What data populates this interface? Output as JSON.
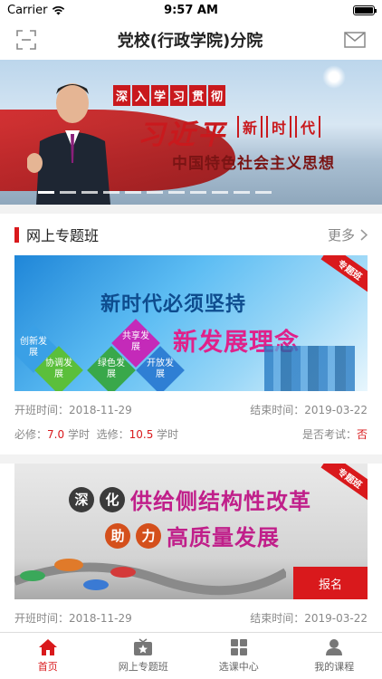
{
  "status_bar": {
    "carrier": "Carrier",
    "time": "9:57 AM"
  },
  "navbar": {
    "title": "党校(行政学院)分院",
    "left_icon": "scan-icon",
    "right_icon": "mail-icon"
  },
  "banner": {
    "tag_chars": [
      "深",
      "入",
      "学",
      "习",
      "贯",
      "彻"
    ],
    "headline": "习近平",
    "headline_side": [
      "新",
      "时",
      "代"
    ],
    "subtitle": "中国特色社会主义思想",
    "dots_count": 11,
    "active_dot": 0
  },
  "section": {
    "title": "网上专题班",
    "more": "更多"
  },
  "courses": [
    {
      "badge": "专题班",
      "image_title": "新时代必须坚持",
      "image_subtitle": "新发展理念",
      "concepts": [
        "创新发展",
        "协调发展",
        "共享发展",
        "绿色发展",
        "开放发展"
      ],
      "start_label": "开班时间：",
      "start": "2018-11-29",
      "end_label": "结束时间：",
      "end": "2019-03-22",
      "required_label": "必修：",
      "required": "7.0",
      "required_unit": "学时",
      "elective_label": "选修：",
      "elective": "10.5",
      "elective_unit": "学时",
      "exam_label": "是否考试：",
      "exam": "否"
    },
    {
      "badge": "专题班",
      "line1_circles": [
        "深",
        "化"
      ],
      "line1_text": "供给侧结构性改革",
      "line2_circles": [
        "助",
        "力"
      ],
      "line2_text": "高质量发展",
      "enroll": "报名",
      "start_label": "开班时间：",
      "start": "2018-11-29",
      "end_label": "结束时间：",
      "end": "2019-03-22"
    }
  ],
  "tabbar": [
    {
      "label": "首页",
      "icon": "home-icon",
      "active": true
    },
    {
      "label": "网上专题班",
      "icon": "online-class-icon",
      "active": false
    },
    {
      "label": "选课中心",
      "icon": "grid-icon",
      "active": false
    },
    {
      "label": "我的课程",
      "icon": "user-icon",
      "active": false
    }
  ],
  "colors": {
    "accent": "#d9191c",
    "muted": "#888888"
  }
}
